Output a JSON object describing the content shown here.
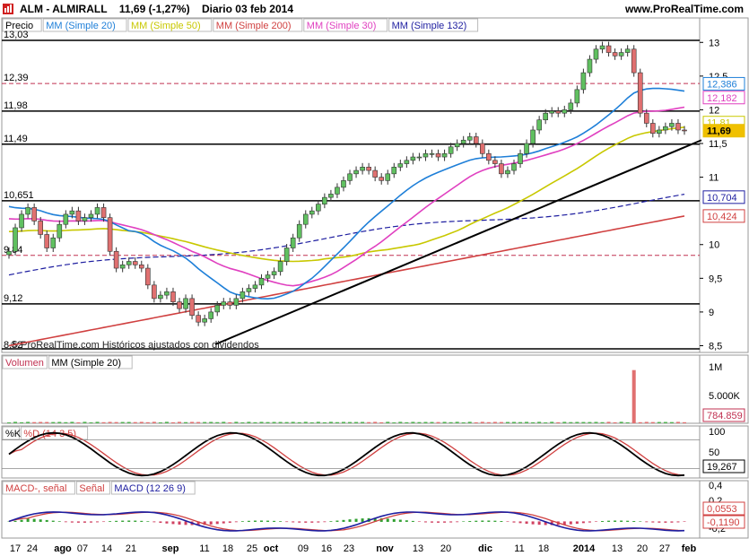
{
  "header": {
    "title": "ALM - ALMIRALL",
    "price": "11,69 (-1,27%)",
    "period": "Diario 03 feb 2014",
    "site": "www.ProRealTime.com"
  },
  "chart_data": [
    {
      "type": "candlestick",
      "panel": "price",
      "legend": [
        "Precio",
        "MM (Simple 20)",
        "MM (Simple 50)",
        "MM (Simple 200)",
        "MM (Simple 30)",
        "MM (Simple 132)"
      ],
      "legend_colors": [
        "#000000",
        "#1e7fd8",
        "#c8c800",
        "#d04040",
        "#e040c0",
        "#1e1ea0"
      ],
      "watermark": "© ProRealTime.com Históricos ajustados con dividendos",
      "y_ticks": [
        "13",
        "12,5",
        "12",
        "11,5",
        "11",
        "10",
        "9,5",
        "9",
        "8,5"
      ],
      "ylim": [
        8.4,
        13.15
      ],
      "horizontal_levels": [
        13.03,
        11.98,
        11.49,
        10.651,
        9.12
      ],
      "horizontal_level_labels": [
        "13,03",
        "11,98",
        "11,49",
        "10,651",
        "9,12"
      ],
      "dashed_levels": [
        12.39,
        9.84
      ],
      "dashed_level_labels": [
        "12,39",
        "9,84"
      ],
      "bottom_left_label": "8,52",
      "value_badges": [
        {
          "label": "12,386",
          "value": 12.386,
          "color": "#1e7fd8"
        },
        {
          "label": "12,182",
          "value": 12.182,
          "color": "#e040c0"
        },
        {
          "label": "11,81",
          "value": 11.81,
          "color": "#c8c800"
        },
        {
          "label": "11,69",
          "value": 11.69,
          "color": "#e8c000"
        },
        {
          "label": "10,704",
          "value": 10.704,
          "color": "#1e1ea0"
        },
        {
          "label": "10,424",
          "value": 10.424,
          "color": "#d04040"
        }
      ],
      "closes": [
        9.9,
        10.25,
        10.45,
        10.55,
        10.35,
        10.15,
        9.95,
        10.1,
        10.3,
        10.45,
        10.5,
        10.35,
        10.4,
        10.45,
        10.55,
        10.4,
        9.9,
        9.65,
        9.7,
        9.75,
        9.7,
        9.65,
        9.4,
        9.2,
        9.25,
        9.3,
        9.15,
        9.05,
        9.2,
        8.95,
        8.85,
        8.9,
        9.0,
        9.1,
        9.15,
        9.1,
        9.2,
        9.3,
        9.35,
        9.4,
        9.5,
        9.55,
        9.6,
        9.75,
        9.95,
        10.1,
        10.3,
        10.45,
        10.5,
        10.6,
        10.7,
        10.75,
        10.85,
        10.95,
        11.05,
        11.1,
        11.15,
        11.1,
        11.0,
        10.95,
        11.05,
        11.15,
        11.2,
        11.25,
        11.3,
        11.3,
        11.35,
        11.35,
        11.3,
        11.35,
        11.45,
        11.5,
        11.55,
        11.6,
        11.5,
        11.35,
        11.25,
        11.2,
        11.05,
        11.1,
        11.2,
        11.35,
        11.5,
        11.7,
        11.85,
        11.95,
        11.98,
        11.95,
        12.0,
        12.1,
        12.3,
        12.55,
        12.75,
        12.9,
        12.95,
        12.85,
        12.8,
        12.85,
        12.9,
        12.55,
        11.95,
        11.8,
        11.65,
        11.7,
        11.75,
        11.8,
        11.7,
        11.69
      ],
      "x_ticks": [
        "17",
        "24",
        "ago",
        "07",
        "14",
        "21",
        "sep",
        "11",
        "18",
        "25",
        "oct",
        "09",
        "16",
        "23",
        "nov",
        "13",
        "20",
        "dic",
        "11",
        "18",
        "2014",
        "13",
        "20",
        "27",
        "feb"
      ]
    },
    {
      "type": "bar",
      "panel": "volume",
      "legend": [
        "Volumen",
        "MM (Simple 20)"
      ],
      "y_ticks": [
        "1M",
        "5.000K"
      ],
      "ylim": [
        0,
        1150000
      ],
      "last_value_label": "784.859",
      "spike_value": 1100000
    },
    {
      "type": "line",
      "panel": "stochastic",
      "legend": [
        "%K",
        "%D (14 3 5)"
      ],
      "y_ticks": [
        "100",
        "50"
      ],
      "ylim": [
        0,
        100
      ],
      "last_value_label": "19,267"
    },
    {
      "type": "histogram",
      "panel": "macd",
      "legend": [
        "MACD-, señal",
        "Señal",
        "MACD (12 26 9)"
      ],
      "y_ticks": [
        "0,4",
        "0,2",
        "0,0553",
        "-0,1190",
        "-0,2"
      ],
      "ylim": [
        -0.25,
        0.45
      ],
      "last_value_labels": [
        "0,0553",
        "-0,1190"
      ]
    }
  ]
}
